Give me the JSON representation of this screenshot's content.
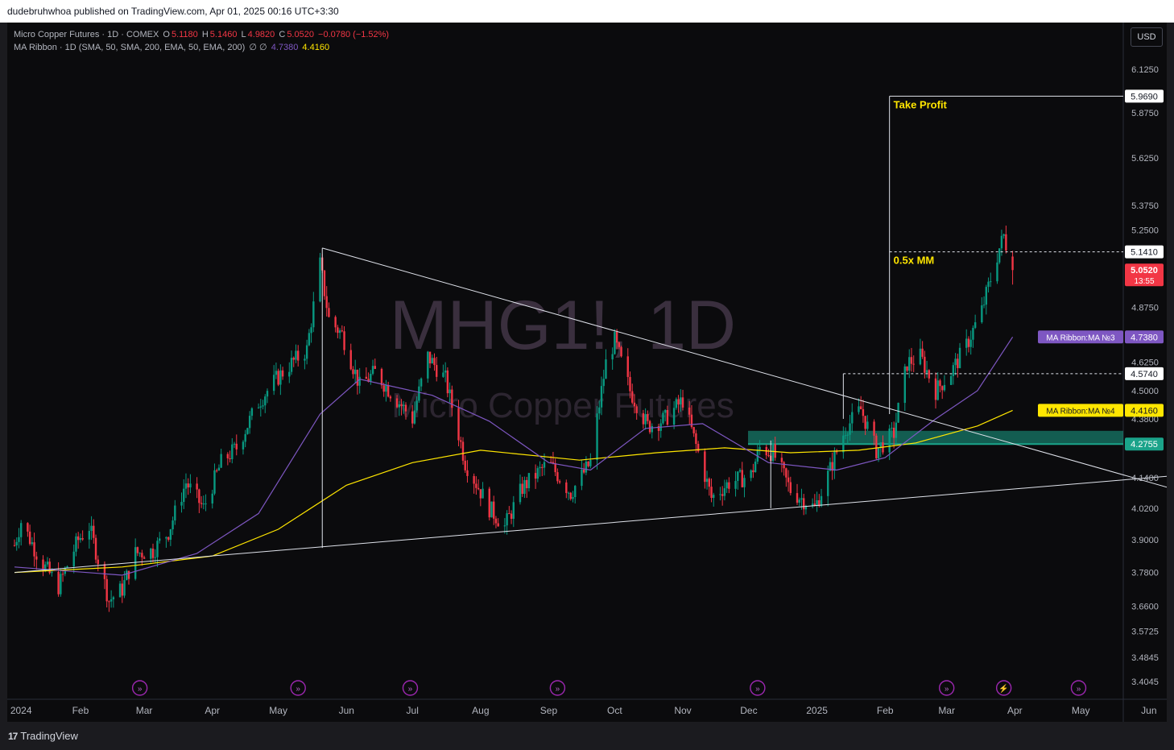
{
  "header": {
    "publisher_text": "dudebruhwhoa published on TradingView.com, Apr 01, 2025 00:16 UTC+3:30"
  },
  "legend": {
    "symbol_line": "Micro Copper Futures · 1D · COMEX",
    "open_label": "O",
    "open": "5.1180",
    "high_label": "H",
    "high": "5.1460",
    "low_label": "L",
    "low": "4.9820",
    "close_label": "C",
    "close": "5.0520",
    "change": "−0.0780 (−1.52%)",
    "indicator_line": "MA Ribbon · 1D (SMA, 50, SMA, 200, EMA, 50, EMA, 200)",
    "indicator_values": "∅ ∅",
    "ma3_value": "4.7380",
    "ma4_value": "4.4160"
  },
  "currency_button": "USD",
  "watermark": {
    "symbol": "MHG1!, 1D",
    "name": "Micro Copper Futures"
  },
  "footer": {
    "brand": "TradingView",
    "logo_text": "17"
  },
  "colors": {
    "background": "#0b0b0d",
    "up_candle": "#089981",
    "down_candle": "#f23645",
    "ma3_purple": "#7e57c2",
    "ma4_yellow": "#ffe600",
    "zone": "#1ba38a",
    "lines": "#e0e3eb"
  },
  "chart_data": {
    "type": "candlestick",
    "symbol": "MHG1!",
    "timeframe": "1D",
    "ylim": [
      3.35,
      6.3
    ],
    "y_ticks": [
      "6.1250",
      "5.8750",
      "5.6250",
      "5.3750",
      "5.2500",
      "4.8750",
      "4.6250",
      "4.5000",
      "4.3800",
      "4.1400",
      "4.0200",
      "3.9000",
      "3.7800",
      "3.6600",
      "3.5725",
      "3.4845",
      "3.4045"
    ],
    "x_ticks": [
      "2024",
      "Feb",
      "Mar",
      "Apr",
      "May",
      "Jun",
      "Jul",
      "Aug",
      "Sep",
      "Oct",
      "Nov",
      "Dec",
      "2025",
      "Feb",
      "Mar",
      "Apr",
      "May",
      "Jun"
    ],
    "price_path": [
      [
        "2024-01-02",
        3.88
      ],
      [
        "2024-01-05",
        3.97
      ],
      [
        "2024-01-14",
        3.82
      ],
      [
        "2024-01-22",
        3.73
      ],
      [
        "2024-01-31",
        3.9
      ],
      [
        "2024-02-05",
        3.95
      ],
      [
        "2024-02-14",
        3.68
      ],
      [
        "2024-02-20",
        3.72
      ],
      [
        "2024-02-26",
        3.85
      ],
      [
        "2024-03-05",
        3.86
      ],
      [
        "2024-03-12",
        3.93
      ],
      [
        "2024-03-20",
        4.12
      ],
      [
        "2024-03-28",
        4.02
      ],
      [
        "2024-04-05",
        4.2
      ],
      [
        "2024-04-12",
        4.26
      ],
      [
        "2024-04-22",
        4.45
      ],
      [
        "2024-04-30",
        4.55
      ],
      [
        "2024-05-07",
        4.62
      ],
      [
        "2024-05-14",
        4.68
      ],
      [
        "2024-05-20",
        5.08
      ],
      [
        "2024-05-24",
        4.82
      ],
      [
        "2024-05-30",
        4.75
      ],
      [
        "2024-06-07",
        4.52
      ],
      [
        "2024-06-14",
        4.58
      ],
      [
        "2024-06-24",
        4.46
      ],
      [
        "2024-07-01",
        4.38
      ],
      [
        "2024-07-08",
        4.65
      ],
      [
        "2024-07-16",
        4.55
      ],
      [
        "2024-07-25",
        4.2
      ],
      [
        "2024-08-05",
        4.02
      ],
      [
        "2024-08-12",
        3.95
      ],
      [
        "2024-08-20",
        4.1
      ],
      [
        "2024-09-01",
        4.2
      ],
      [
        "2024-09-11",
        4.08
      ],
      [
        "2024-09-20",
        4.2
      ],
      [
        "2024-09-27",
        4.62
      ],
      [
        "2024-10-01",
        4.72
      ],
      [
        "2024-10-08",
        4.5
      ],
      [
        "2024-10-16",
        4.35
      ],
      [
        "2024-10-24",
        4.38
      ],
      [
        "2024-11-01",
        4.46
      ],
      [
        "2024-11-06",
        4.3
      ],
      [
        "2024-11-14",
        4.06
      ],
      [
        "2024-11-22",
        4.12
      ],
      [
        "2024-12-02",
        4.15
      ],
      [
        "2024-12-06",
        4.26
      ],
      [
        "2024-12-12",
        4.24
      ],
      [
        "2024-12-20",
        4.09
      ],
      [
        "2024-12-31",
        4.02
      ],
      [
        "2025-01-06",
        4.15
      ],
      [
        "2025-01-14",
        4.34
      ],
      [
        "2025-01-21",
        4.42
      ],
      [
        "2025-01-28",
        4.25
      ],
      [
        "2025-02-05",
        4.32
      ],
      [
        "2025-02-11",
        4.62
      ],
      [
        "2025-02-17",
        4.65
      ],
      [
        "2025-02-24",
        4.5
      ],
      [
        "2025-03-03",
        4.58
      ],
      [
        "2025-03-10",
        4.7
      ],
      [
        "2025-03-17",
        4.86
      ],
      [
        "2025-03-25",
        5.16
      ],
      [
        "2025-03-27",
        5.22
      ],
      [
        "2025-03-31",
        5.05
      ]
    ],
    "last_candle": {
      "open": 5.118,
      "high": 5.146,
      "low": 4.982,
      "close": 5.052
    },
    "ma3_sma": [
      [
        "2024-01-02",
        3.8
      ],
      [
        "2024-02-20",
        3.77
      ],
      [
        "2024-03-25",
        3.85
      ],
      [
        "2024-04-22",
        4.0
      ],
      [
        "2024-05-20",
        4.4
      ],
      [
        "2024-06-07",
        4.55
      ],
      [
        "2024-07-10",
        4.48
      ],
      [
        "2024-08-05",
        4.37
      ],
      [
        "2024-09-01",
        4.2
      ],
      [
        "2024-09-20",
        4.17
      ],
      [
        "2024-10-15",
        4.34
      ],
      [
        "2024-11-10",
        4.36
      ],
      [
        "2024-12-10",
        4.2
      ],
      [
        "2025-01-10",
        4.17
      ],
      [
        "2025-02-01",
        4.22
      ],
      [
        "2025-02-24",
        4.38
      ],
      [
        "2025-03-15",
        4.5
      ],
      [
        "2025-03-31",
        4.738
      ]
    ],
    "ma4_sma": [
      [
        "2024-01-02",
        3.78
      ],
      [
        "2024-02-20",
        3.8
      ],
      [
        "2024-04-01",
        3.84
      ],
      [
        "2024-05-01",
        3.94
      ],
      [
        "2024-06-01",
        4.11
      ],
      [
        "2024-07-01",
        4.2
      ],
      [
        "2024-08-01",
        4.25
      ],
      [
        "2024-09-15",
        4.21
      ],
      [
        "2024-10-20",
        4.24
      ],
      [
        "2024-11-20",
        4.26
      ],
      [
        "2024-12-20",
        4.24
      ],
      [
        "2025-01-20",
        4.25
      ],
      [
        "2025-02-15",
        4.28
      ],
      [
        "2025-03-15",
        4.35
      ],
      [
        "2025-03-31",
        4.416
      ]
    ],
    "trendlines": [
      {
        "from": [
          "2024-05-21",
          5.16
        ],
        "to": [
          "2025-06-10",
          4.1
        ]
      },
      {
        "from": [
          "2024-01-02",
          3.78
        ],
        "to": [
          "2025-06-10",
          4.146
        ]
      }
    ],
    "annotations": [
      {
        "text": "Take Profit",
        "price": 5.969
      },
      {
        "text": "0.5x MM",
        "price": 5.141
      },
      {
        "price": 4.574
      },
      {
        "zone": [
          4.2755,
          4.33
        ]
      }
    ],
    "price_tags": [
      {
        "label": "5.9690",
        "value": 5.969
      },
      {
        "label": "5.1410",
        "value": 5.141
      },
      {
        "label": "5.0520",
        "sub": "13:55",
        "value": 5.052
      },
      {
        "label": "4.7380",
        "name": "MA Ribbon:MA №3",
        "value": 4.738
      },
      {
        "label": "4.5740",
        "value": 4.574
      },
      {
        "label": "4.4160",
        "name": "MA Ribbon:MA №4",
        "value": 4.416
      },
      {
        "label": "4.2755",
        "value": 4.2755
      }
    ],
    "event_markers": [
      "2024-02-28",
      "2024-05-10",
      "2024-06-30",
      "2024-09-05",
      "2024-12-05",
      "2025-03-01",
      "2025-03-27",
      "2025-04-30"
    ]
  }
}
